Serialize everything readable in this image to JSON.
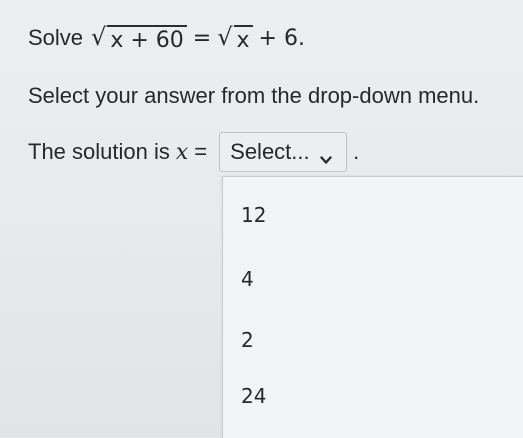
{
  "problem": {
    "prefix": "Solve",
    "lhs_radicand": "x + 60",
    "equals": "=",
    "rhs_radicand": "x",
    "rhs_tail": "+ 6."
  },
  "instruction": "Select your answer from the drop-down menu.",
  "answer": {
    "prefix": "The solution is",
    "variable": "x",
    "equals": "=",
    "select_placeholder": "Select...",
    "period": "."
  },
  "dropdown": {
    "options": [
      "12",
      "4",
      "2",
      "24"
    ]
  },
  "icons": {
    "select_chevron": "chevron-down-icon"
  },
  "colors": {
    "background": "#e7e8ea",
    "text": "#26282c",
    "dropdown_background": "#f2f3f5",
    "border": "#bfc1c5"
  }
}
